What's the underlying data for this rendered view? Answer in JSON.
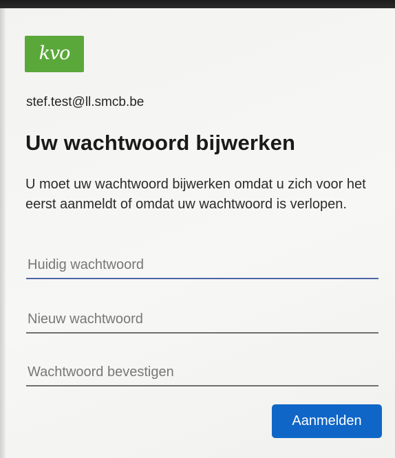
{
  "logo": {
    "text": "kvo",
    "color": "#5aa83a"
  },
  "account": {
    "email": "stef.test@ll.smcb.be"
  },
  "page": {
    "title": "Uw wachtwoord bijwerken",
    "description": "U moet uw wachtwoord bijwerken omdat u zich voor het eerst aanmeldt of omdat uw wachtwoord is verlopen."
  },
  "form": {
    "current_password": {
      "placeholder": "Huidig wachtwoord",
      "value": ""
    },
    "new_password": {
      "placeholder": "Nieuw wachtwoord",
      "value": ""
    },
    "confirm_password": {
      "placeholder": "Wachtwoord bevestigen",
      "value": ""
    },
    "submit_label": "Aanmelden",
    "submit_color": "#0f66c7"
  }
}
